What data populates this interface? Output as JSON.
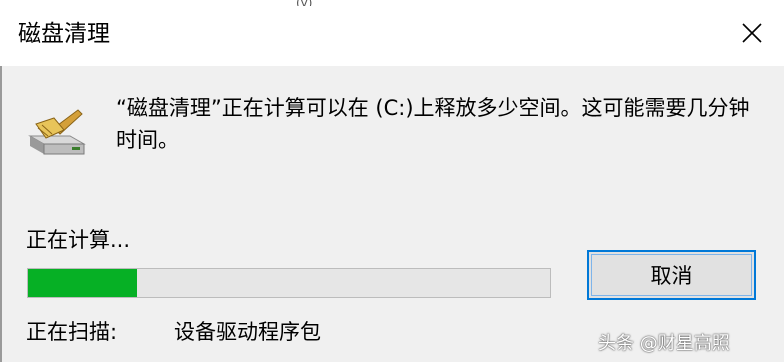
{
  "window": {
    "title": "磁盘清理",
    "top_bleed_text": "(y)"
  },
  "dialog": {
    "message": "“磁盘清理”正在计算可以在 (C:)上释放多少空间。这可能需要几分钟时间。",
    "status_label": "正在计算...",
    "progress_fraction": 0.208,
    "cancel_label": "取消",
    "scan_label": "正在扫描:",
    "scan_item": "设备驱动程序包"
  },
  "watermark": {
    "text": "头条 @财星高照"
  },
  "colors": {
    "progress_fill": "#06b025",
    "button_focus_border": "#0078d7",
    "dialog_background": "#f0f0f0",
    "titlebar_background": "#ffffff"
  },
  "icons": {
    "close": "close-icon",
    "app": "disk-cleanup-icon"
  }
}
